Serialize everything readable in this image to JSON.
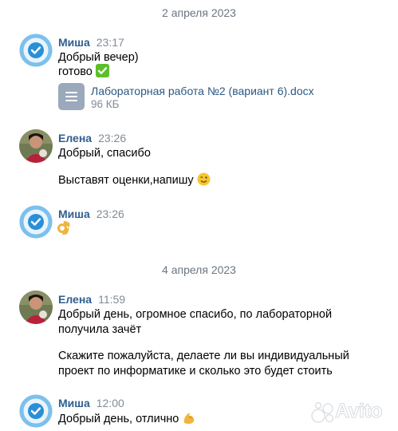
{
  "date_separators": [
    "2 апреля 2023",
    "4 апреля 2023"
  ],
  "messages": [
    {
      "author": "Миша",
      "time": "23:17",
      "lines": [
        "Добрый вечер)",
        "готово"
      ],
      "emoji": "check-mark-button",
      "attachment": {
        "name": "Лабораторная работа №2 (вариант 6).docx",
        "size": "96 КБ"
      }
    },
    {
      "author": "Елена",
      "time": "23:26",
      "lines": [
        "Добрый, спасибо",
        "Выставят оценки,напишу"
      ],
      "emoji": "winking-face"
    },
    {
      "author": "Миша",
      "time": "23:26",
      "emoji": "ok-hand"
    },
    {
      "author": "Елена",
      "time": "11:59",
      "lines": [
        "Добрый день, огромное спасибо, по лабораторной",
        "получила зачёт",
        "Скажите пожалуйста, делаете ли вы индивидуальный",
        "проект по информатике и сколько это будет стоить"
      ]
    },
    {
      "author": "Миша",
      "time": "12:00",
      "lines": [
        "Добрый день, отлично"
      ],
      "emoji": "flexed-biceps"
    }
  ],
  "watermark": "Avito",
  "colors": {
    "author": "#2f5f8f",
    "time": "#828b95",
    "date": "#6b7580",
    "link": "#2a5885",
    "file_icon": "#9aa9bb",
    "badge_blue": "#2a8fd6"
  }
}
